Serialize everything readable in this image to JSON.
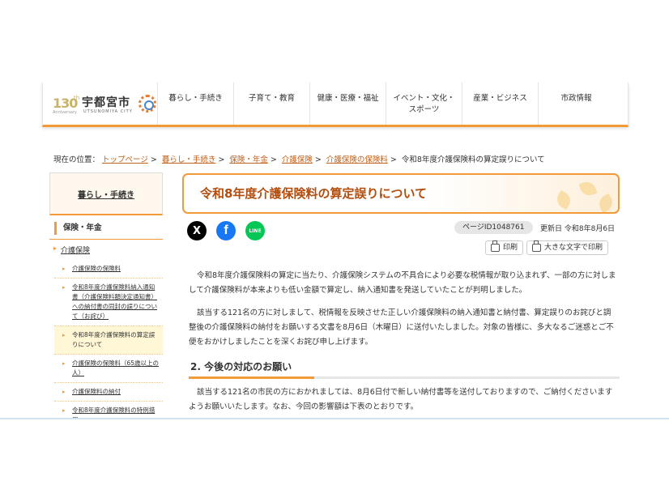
{
  "logo": {
    "anniversary": "130",
    "anniversary_suffix": "th",
    "anniversary_label": "Anniversary",
    "city_jp": "宇都宮市",
    "city_en": "UTSUNOMIYA CITY"
  },
  "nav": [
    {
      "label": "暮らし・手続き"
    },
    {
      "label": "子育て・教育"
    },
    {
      "label": "健康・医療・福祉"
    },
    {
      "label": "イベント・文化・スポーツ"
    },
    {
      "label": "産業・ビジネス"
    },
    {
      "label": "市政情報"
    }
  ],
  "breadcrumb": {
    "prefix": "現在の位置：",
    "items": [
      "トップページ",
      "暮らし・手続き",
      "保険・年金",
      "介護保険",
      "介護保険の保険料"
    ],
    "current": "令和8年度介護保険料の算定誤りについて"
  },
  "sidebar": {
    "heading": "暮らし・手続き",
    "category": "保険・年金",
    "sub": "介護保険",
    "links": [
      "介護保険の保険料",
      "令和8年度介護保険料納入通知書（介護保険料額決定通知書）への納付書の同封の誤りについて（お詫び）",
      "令和8年度介護保険料の算定誤りについて",
      "介護保険の保険料（65歳以上の人）",
      "介護保険料の納付",
      "令和8年度介護保険料の特例措置"
    ]
  },
  "main": {
    "title": "令和8年度介護保険料の算定誤りについて",
    "page_id": "ページID1048761",
    "updated": "更新日 令和8年8月6日",
    "print_label": "印刷",
    "large_print_label": "大きな文字で印刷",
    "share": {
      "x": "X",
      "facebook": "f",
      "line": "LINE"
    },
    "para1": "令和8年度介護保険料の算定に当たり、介護保険システムの不具合により必要な税情報が取り込まれず、一部の方に対しまして介護保険料が本来よりも低い金額で算定し、納入通知書を発送していたことが判明しました。",
    "para2": "該当する121名の方に対しまして、税情報を反映させた正しい介護保険料の納入通知書と納付書、算定誤りのお詫びと調整後の介護保険料の納付をお願いする文書を8月6日（木曜日）に送付いたしました。対象の皆様に、多大なるご迷惑とご不便をおかけしましたことを深くお詫び申し上げます。",
    "heading2": "2. 今後の対応のお願い",
    "para3": "該当する121名の市民の方におかれましては、8月6日付で新しい納付書等を送付しておりますので、ご納付くださいますようお願いいたします。なお、今回の影響額は下表のとおりです。"
  }
}
